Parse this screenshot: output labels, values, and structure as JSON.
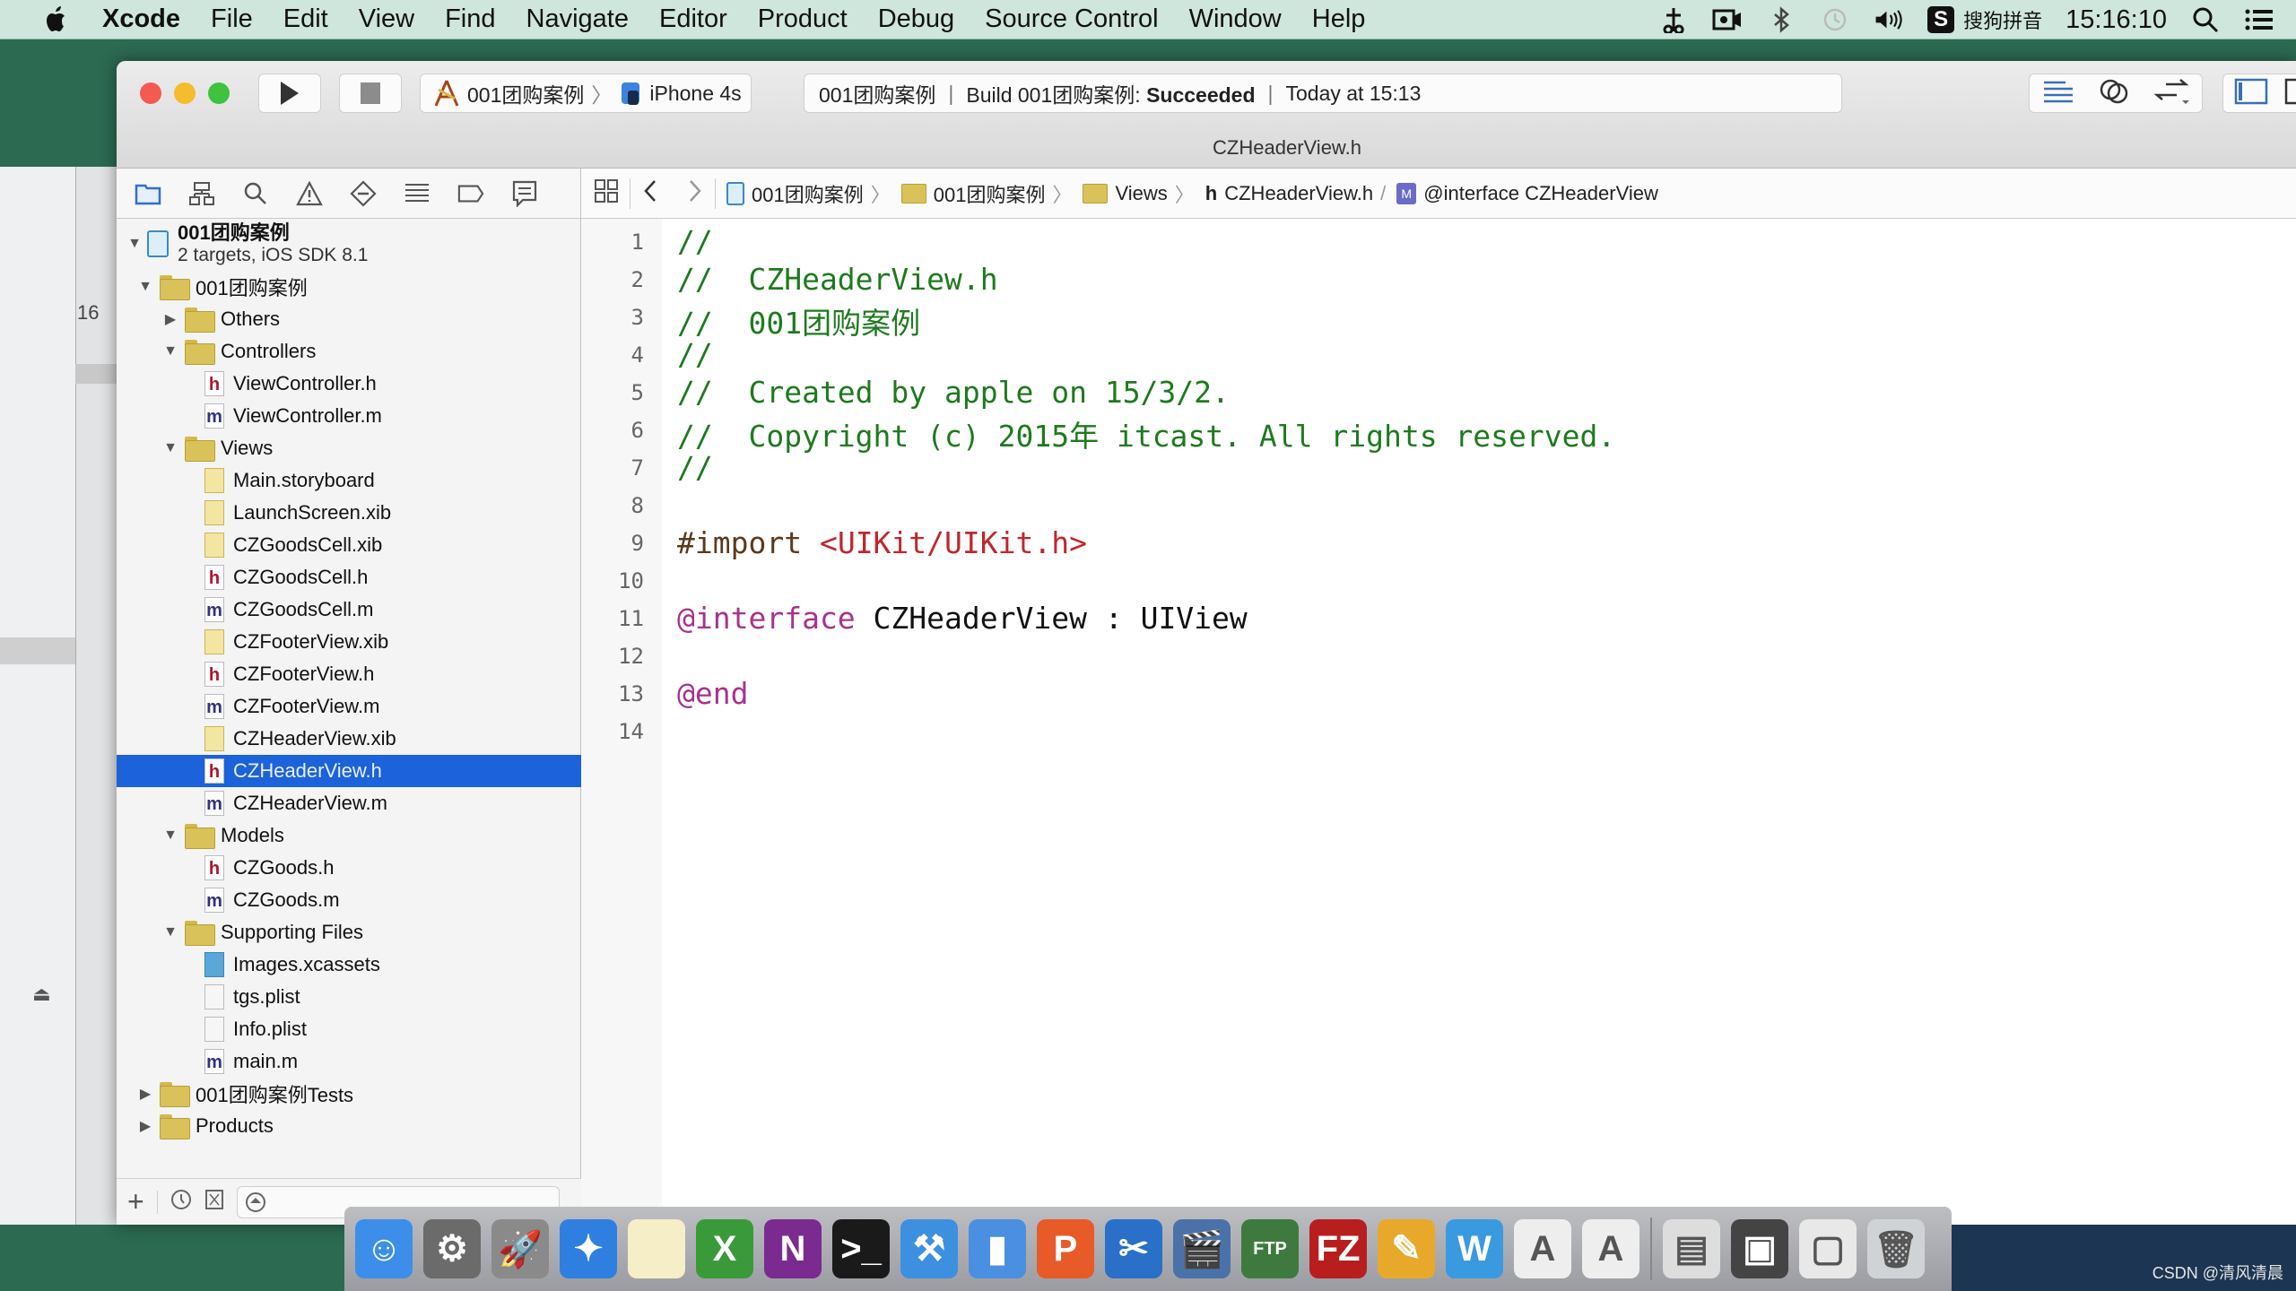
{
  "menubar": {
    "apple_icon": "apple-logo",
    "items": [
      "Xcode",
      "File",
      "Edit",
      "View",
      "Find",
      "Navigate",
      "Editor",
      "Product",
      "Debug",
      "Source Control",
      "Window",
      "Help"
    ],
    "status": {
      "ime_badge": "S",
      "ime_label": "搜狗拼音",
      "clock": "15:16:10"
    }
  },
  "background_window": {
    "line_number": "16"
  },
  "toolbar": {
    "scheme_name": "001团购案例",
    "scheme_separator": "〉",
    "device": "iPhone 4s",
    "activity": {
      "project": "001团购案例",
      "build_prefix": "Build 001团购案例:",
      "build_status": "Succeeded",
      "time": "Today at 15:13",
      "separator": "|"
    }
  },
  "window": {
    "title": "CZHeaderView.h"
  },
  "jumpbar": {
    "crumbs": [
      "001团购案例",
      "001团购案例",
      "Views",
      "CZHeaderView.h",
      "@interface CZHeaderView"
    ],
    "separator": "〉"
  },
  "navigator": {
    "project": {
      "name": "001团购案例",
      "subtitle": "2 targets, iOS SDK 8.1"
    },
    "items": [
      {
        "label": "001团购案例",
        "type": "folder",
        "level": 1,
        "expanded": true
      },
      {
        "label": "Others",
        "type": "folder",
        "level": 2,
        "expanded": false
      },
      {
        "label": "Controllers",
        "type": "folder",
        "level": 2,
        "expanded": true
      },
      {
        "label": "ViewController.h",
        "type": "h",
        "level": 3
      },
      {
        "label": "ViewController.m",
        "type": "m",
        "level": 3
      },
      {
        "label": "Views",
        "type": "folder",
        "level": 2,
        "expanded": true
      },
      {
        "label": "Main.storyboard",
        "type": "xib",
        "level": 3
      },
      {
        "label": "LaunchScreen.xib",
        "type": "xib",
        "level": 3
      },
      {
        "label": "CZGoodsCell.xib",
        "type": "xib",
        "level": 3
      },
      {
        "label": "CZGoodsCell.h",
        "type": "h",
        "level": 3
      },
      {
        "label": "CZGoodsCell.m",
        "type": "m",
        "level": 3
      },
      {
        "label": "CZFooterView.xib",
        "type": "xib",
        "level": 3
      },
      {
        "label": "CZFooterView.h",
        "type": "h",
        "level": 3
      },
      {
        "label": "CZFooterView.m",
        "type": "m",
        "level": 3
      },
      {
        "label": "CZHeaderView.xib",
        "type": "xib",
        "level": 3
      },
      {
        "label": "CZHeaderView.h",
        "type": "h",
        "level": 3,
        "selected": true
      },
      {
        "label": "CZHeaderView.m",
        "type": "m",
        "level": 3
      },
      {
        "label": "Models",
        "type": "folder",
        "level": 2,
        "expanded": true
      },
      {
        "label": "CZGoods.h",
        "type": "h",
        "level": 3
      },
      {
        "label": "CZGoods.m",
        "type": "m",
        "level": 3
      },
      {
        "label": "Supporting Files",
        "type": "folder",
        "level": 2,
        "expanded": true
      },
      {
        "label": "Images.xcassets",
        "type": "assets",
        "level": 3
      },
      {
        "label": "tgs.plist",
        "type": "plist",
        "level": 3
      },
      {
        "label": "Info.plist",
        "type": "plist",
        "level": 3
      },
      {
        "label": "main.m",
        "type": "m",
        "level": 3
      },
      {
        "label": "001团购案例Tests",
        "type": "folder",
        "level": 1,
        "expanded": false
      },
      {
        "label": "Products",
        "type": "folder",
        "level": 1,
        "expanded": false
      }
    ],
    "filter_add_label": "+"
  },
  "editor": {
    "lines": [
      {
        "n": "1",
        "tokens": [
          {
            "t": "//",
            "c": "comment"
          }
        ]
      },
      {
        "n": "2",
        "tokens": [
          {
            "t": "//  CZHeaderView.h",
            "c": "comment"
          }
        ]
      },
      {
        "n": "3",
        "tokens": [
          {
            "t": "//  001团购案例",
            "c": "comment"
          }
        ]
      },
      {
        "n": "4",
        "tokens": [
          {
            "t": "//",
            "c": "comment"
          }
        ]
      },
      {
        "n": "5",
        "tokens": [
          {
            "t": "//  Created by apple on 15/3/2.",
            "c": "comment"
          }
        ]
      },
      {
        "n": "6",
        "tokens": [
          {
            "t": "//  Copyright (c) 2015年 itcast. All rights reserved.",
            "c": "comment"
          }
        ]
      },
      {
        "n": "7",
        "tokens": [
          {
            "t": "//",
            "c": "comment"
          }
        ]
      },
      {
        "n": "8",
        "tokens": []
      },
      {
        "n": "9",
        "tokens": [
          {
            "t": "#import ",
            "c": "pre"
          },
          {
            "t": "<UIKit/UIKit.h>",
            "c": "str"
          }
        ]
      },
      {
        "n": "10",
        "tokens": []
      },
      {
        "n": "11",
        "tokens": [
          {
            "t": "@interface",
            "c": "kw"
          },
          {
            "t": " CZHeaderView : UIView",
            "c": "plain"
          }
        ]
      },
      {
        "n": "12",
        "tokens": []
      },
      {
        "n": "13",
        "tokens": [
          {
            "t": "@end",
            "c": "kw"
          }
        ]
      },
      {
        "n": "14",
        "tokens": []
      }
    ]
  },
  "dock": {
    "apps": [
      {
        "name": "finder",
        "glyph": "☺",
        "bg": "#3d8ee8"
      },
      {
        "name": "system-preferences",
        "glyph": "⚙",
        "bg": "#6b6b6b"
      },
      {
        "name": "launchpad",
        "glyph": "🚀",
        "bg": "#8a8a8a"
      },
      {
        "name": "safari",
        "glyph": "✦",
        "bg": "#2f7fe0"
      },
      {
        "name": "notes",
        "glyph": "",
        "bg": "#f5eec6"
      },
      {
        "name": "excel",
        "glyph": "X",
        "bg": "#3a9a3a"
      },
      {
        "name": "onenote",
        "glyph": "N",
        "bg": "#7b2b8f"
      },
      {
        "name": "terminal",
        "glyph": ">_",
        "bg": "#1a1a1a"
      },
      {
        "name": "xcode",
        "glyph": "⚒",
        "bg": "#3d8fe0"
      },
      {
        "name": "simulator",
        "glyph": "▮",
        "bg": "#4a8fe0"
      },
      {
        "name": "pages",
        "glyph": "P",
        "bg": "#e85a28"
      },
      {
        "name": "scissors-tool",
        "glyph": "✂",
        "bg": "#2a6fc8"
      },
      {
        "name": "video-app",
        "glyph": "🎬",
        "bg": "#4a72a8"
      },
      {
        "name": "ftp-app",
        "glyph": "FTP",
        "bg": "#3e7a3e"
      },
      {
        "name": "filezilla",
        "glyph": "FZ",
        "bg": "#b81e1e"
      },
      {
        "name": "pencil-app",
        "glyph": "✎",
        "bg": "#e8a92a"
      },
      {
        "name": "word",
        "glyph": "W",
        "bg": "#3a9ae0"
      },
      {
        "name": "document-a",
        "glyph": "A",
        "bg": "#eeeeee"
      },
      {
        "name": "document-b",
        "glyph": "A",
        "bg": "#eeeeee"
      },
      {
        "name": "stack-1",
        "glyph": "▤",
        "bg": "#dddddd"
      },
      {
        "name": "stack-2",
        "glyph": "▣",
        "bg": "#444444"
      },
      {
        "name": "stack-3",
        "glyph": "▢",
        "bg": "#e8e8e8"
      },
      {
        "name": "trash",
        "glyph": "🗑",
        "bg": "#cfd3d6"
      }
    ]
  },
  "watermark": "CSDN @清风清晨",
  "colors": {
    "selection": "#1b62db",
    "comment": "#1e7a1e",
    "keyword": "#a8328f",
    "string": "#c0272d",
    "build_succeeded": "#111111"
  }
}
